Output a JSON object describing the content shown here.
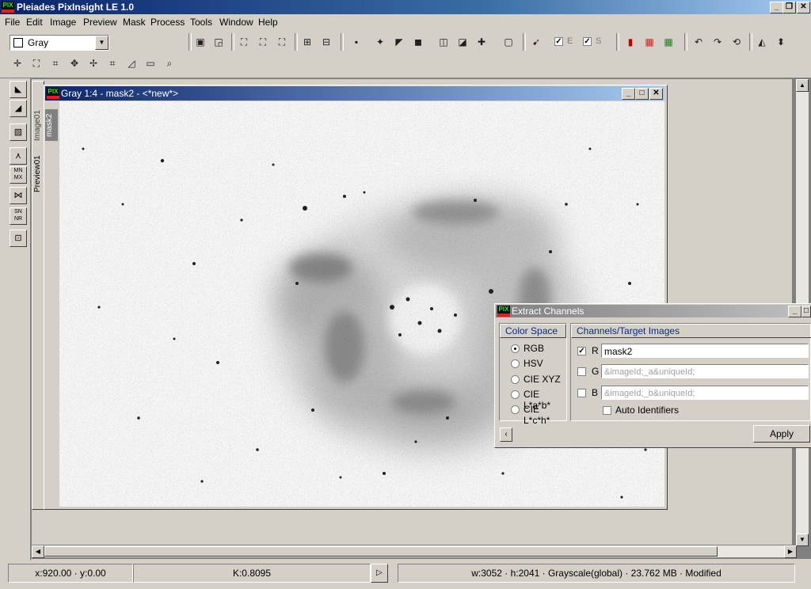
{
  "app": {
    "title": "Pleiades PixInsight LE 1.0"
  },
  "menu": [
    "File",
    "Edit",
    "Image",
    "Preview",
    "Mask",
    "Process",
    "Tools",
    "Window",
    "Help"
  ],
  "toolbar": {
    "colorspace_combo": "Gray",
    "e_label": "E",
    "s_label": "S"
  },
  "image_window": {
    "title": "Gray 1:4 - mask2 - <*new*>",
    "tabs": [
      "mask2",
      "Image01",
      "Preview01"
    ]
  },
  "dialog": {
    "title": "Extract Channels",
    "color_space_header": "Color Space",
    "channels_header": "Channels/Target Images",
    "color_spaces": [
      {
        "label": "RGB",
        "selected": true
      },
      {
        "label": "HSV",
        "selected": false
      },
      {
        "label": "CIE XYZ",
        "selected": false
      },
      {
        "label": "CIE L*a*b*",
        "selected": false
      },
      {
        "label": "CIE L*c*h*",
        "selected": false
      }
    ],
    "channels": [
      {
        "label": "R",
        "checked": true,
        "value": "mask2",
        "enabled": true
      },
      {
        "label": "G",
        "checked": false,
        "value": "&imageId;_a&uniqueId;",
        "enabled": false
      },
      {
        "label": "B",
        "checked": false,
        "value": "&imageId;_b&uniqueId;",
        "enabled": false
      }
    ],
    "auto_identifiers_label": "Auto Identifiers",
    "auto_identifiers_checked": false,
    "apply_label": "Apply"
  },
  "status": {
    "coords": "x:920.00 · y:0.00",
    "k_value": "K:0.8095",
    "image_info": "w:3052 · h:2041 · Grayscale(global) · 23.762 MB · Modified"
  }
}
